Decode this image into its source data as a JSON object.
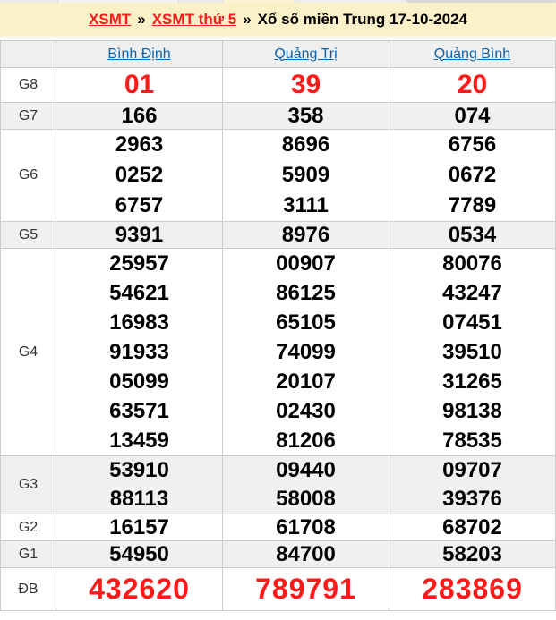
{
  "breadcrumb": {
    "links": [
      "XSMT",
      "XSMT thứ 5"
    ],
    "separator": "»",
    "current": "Xổ số miền Trung 17-10-2024"
  },
  "table": {
    "provinces": [
      "Bình Định",
      "Quảng Trị",
      "Quảng Bình"
    ],
    "rows": [
      {
        "id": "g8",
        "label": "G8",
        "red": true,
        "values": [
          [
            "01"
          ],
          [
            "39"
          ],
          [
            "20"
          ]
        ]
      },
      {
        "id": "g7",
        "label": "G7",
        "values": [
          [
            "166"
          ],
          [
            "358"
          ],
          [
            "074"
          ]
        ]
      },
      {
        "id": "g6",
        "label": "G6",
        "values": [
          [
            "2963",
            "0252",
            "6757"
          ],
          [
            "8696",
            "5909",
            "3111"
          ],
          [
            "6756",
            "0672",
            "7789"
          ]
        ]
      },
      {
        "id": "g5",
        "label": "G5",
        "values": [
          [
            "9391"
          ],
          [
            "8976"
          ],
          [
            "0534"
          ]
        ]
      },
      {
        "id": "g4",
        "label": "G4",
        "values": [
          [
            "25957",
            "54621",
            "16983",
            "91933",
            "05099",
            "63571",
            "13459"
          ],
          [
            "00907",
            "86125",
            "65105",
            "74099",
            "20107",
            "02430",
            "81206"
          ],
          [
            "80076",
            "43247",
            "07451",
            "39510",
            "31265",
            "98138",
            "78535"
          ]
        ]
      },
      {
        "id": "g3",
        "label": "G3",
        "values": [
          [
            "53910",
            "88113"
          ],
          [
            "09440",
            "58008"
          ],
          [
            "09707",
            "39376"
          ]
        ]
      },
      {
        "id": "g2",
        "label": "G2",
        "values": [
          [
            "16157"
          ],
          [
            "61708"
          ],
          [
            "68702"
          ]
        ]
      },
      {
        "id": "g1",
        "label": "G1",
        "values": [
          [
            "54950"
          ],
          [
            "84700"
          ],
          [
            "58203"
          ]
        ]
      },
      {
        "id": "db",
        "label": "ĐB",
        "red": true,
        "values": [
          [
            "432620"
          ],
          [
            "789791"
          ],
          [
            "283869"
          ]
        ]
      }
    ]
  },
  "colors": {
    "breadcrumb_bg": "#fbf0c8",
    "highlight_red": "#ff1a1a",
    "link_blue": "#0a64ad",
    "shaded_row": "#f0f0f0",
    "border": "#cccccc"
  }
}
